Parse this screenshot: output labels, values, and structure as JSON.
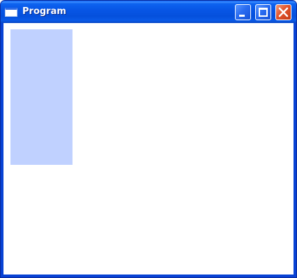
{
  "window": {
    "title": "Program"
  },
  "titlebar": {
    "app_icon": "window-icon",
    "buttons": {
      "minimize": "minimize-icon",
      "maximize": "maximize-icon",
      "close": "close-icon"
    }
  },
  "colors": {
    "titlebar": "#0550dc",
    "client_background": "#ffffff",
    "panel": "#c0d1ff",
    "close_button": "#e2542c"
  }
}
